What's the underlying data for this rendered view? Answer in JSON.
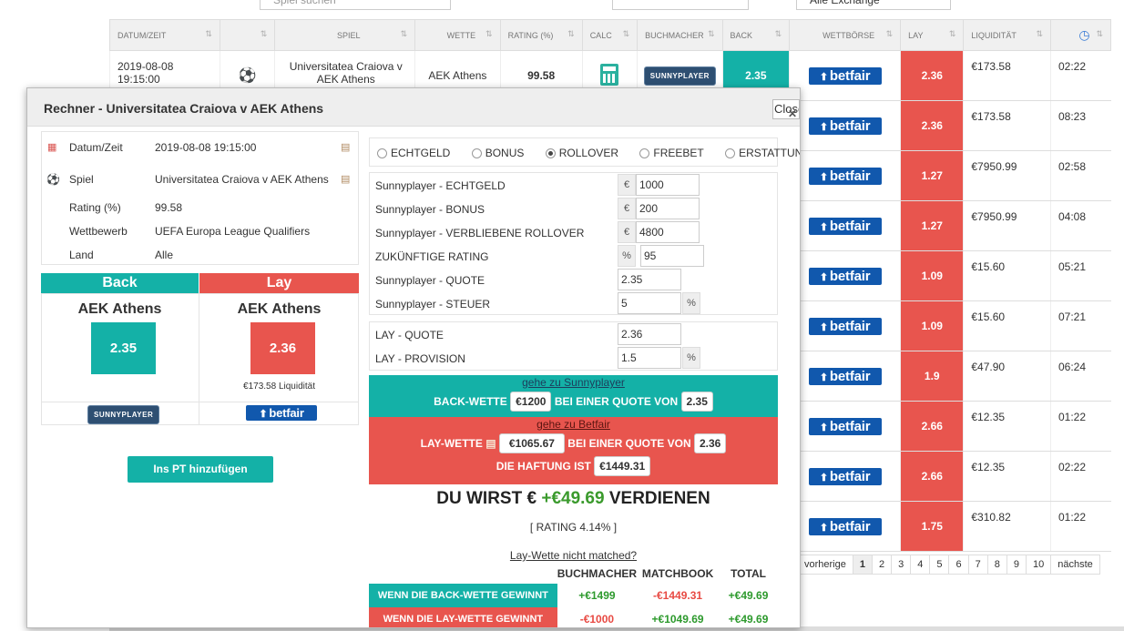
{
  "top": {
    "search_placeholder": "Spiel suchen",
    "exchange_select": "Alle Exchange"
  },
  "grid": {
    "headers": [
      "DATUM/ZEIT",
      "",
      "SPIEL",
      "WETTE",
      "RATING (%)",
      "CALC",
      "BUCHMACHER",
      "BACK",
      "WETTBÖRSE",
      "LAY",
      "LIQUIDITÄT",
      ""
    ],
    "first_row": {
      "date": "2019-08-08",
      "time": "19:15:00",
      "match": "Universitatea Craiova v AEK Athens",
      "bet": "AEK Athens",
      "rating": "99.58",
      "bookmaker": "SUNNYPLAYER",
      "back": "2.35"
    },
    "rows": [
      {
        "lay": "2.36",
        "liq": "€173.58",
        "time": "02:22"
      },
      {
        "lay": "2.36",
        "liq": "€173.58",
        "time": "08:23"
      },
      {
        "lay": "1.27",
        "liq": "€7950.99",
        "time": "02:58"
      },
      {
        "lay": "1.27",
        "liq": "€7950.99",
        "time": "04:08"
      },
      {
        "lay": "1.09",
        "liq": "€15.60",
        "time": "05:21"
      },
      {
        "lay": "1.09",
        "liq": "€15.60",
        "time": "07:21"
      },
      {
        "lay": "1.9",
        "liq": "€47.90",
        "time": "06:24"
      },
      {
        "lay": "2.66",
        "liq": "€12.35",
        "time": "01:22"
      },
      {
        "lay": "2.66",
        "liq": "€12.35",
        "time": "02:22"
      },
      {
        "lay": "1.75",
        "liq": "€310.82",
        "time": "01:22"
      }
    ],
    "exchange_logo": "betfair"
  },
  "pager": {
    "prev": "vorherige",
    "pages": [
      "1",
      "2",
      "3",
      "4",
      "5",
      "6",
      "7",
      "8",
      "9",
      "10"
    ],
    "next": "nächste"
  },
  "modal": {
    "title": "Rechner - Universitatea Craiova v AEK Athens",
    "close": "Close",
    "info": [
      {
        "label": "Datum/Zeit",
        "value": "2019-08-08 19:15:00"
      },
      {
        "label": "Spiel",
        "value": "Universitatea Craiova v AEK Athens"
      },
      {
        "label": "Rating (%)",
        "value": "99.58"
      },
      {
        "label": "Wettbewerb",
        "value": "UEFA Europa League Qualifiers"
      },
      {
        "label": "Land",
        "value": "Alle"
      }
    ],
    "back": {
      "head": "Back",
      "team": "AEK Athens",
      "odds": "2.35",
      "bookmaker": "SUNNYPLAYER"
    },
    "lay": {
      "head": "Lay",
      "team": "AEK Athens",
      "odds": "2.36",
      "liquidity": "€173.58 Liquidität",
      "exchange": "betfair"
    },
    "add_button": "Ins PT hinzufügen",
    "radios": [
      "ECHTGELD",
      "BONUS",
      "ROLLOVER",
      "FREEBET",
      "ERSTATTUNG"
    ],
    "radio_selected": "ROLLOVER",
    "fields": {
      "echtgeld_label": "Sunnyplayer - ECHTGELD",
      "echtgeld": "1000",
      "bonus_label": "Sunnyplayer - BONUS",
      "bonus": "200",
      "rollover_label": "Sunnyplayer - VERBLIEBENE ROLLOVER",
      "rollover": "4800",
      "future_label": "ZUKÜNFTIGE RATING",
      "future": "95",
      "quote_label": "Sunnyplayer - QUOTE",
      "quote": "2.35",
      "tax_label": "Sunnyplayer - STEUER",
      "tax": "5",
      "lay_quote_label": "LAY - QUOTE",
      "lay_quote": "2.36",
      "lay_prov_label": "LAY - PROVISION",
      "lay_prov": "1.5",
      "euro": "€",
      "pct": "%"
    },
    "back_box": {
      "link": "gehe zu Sunnyplayer",
      "pre": "BACK-WETTE",
      "stake": "€1200",
      "mid": "BEI EINER QUOTE VON",
      "odds": "2.35"
    },
    "lay_box": {
      "link": "gehe zu Betfair",
      "pre": "LAY-WETTE",
      "stake": "€1065.67",
      "mid": "BEI EINER QUOTE VON",
      "odds": "2.36",
      "liab_label": "DIE HAFTUNG IST",
      "liab": "€1449.31"
    },
    "result": {
      "pre": "DU WIRST €",
      "amount": "+€49.69",
      "post": "VERDIENEN",
      "rating": "[ RATING 4.14% ]"
    },
    "not_matched": "Lay-Wette nicht matched?",
    "outcome": {
      "headers": [
        "BUCHMACHER",
        "MATCHBOOK",
        "TOTAL"
      ],
      "back_label": "WENN DIE BACK-WETTE GEWINNT",
      "back_vals": [
        "+€1499",
        "-€1449.31",
        "+€49.69"
      ],
      "lay_label": "WENN DIE LAY-WETTE GEWINNT",
      "lay_vals": [
        "-€1000",
        "+€1049.69",
        "+€49.69"
      ]
    }
  }
}
